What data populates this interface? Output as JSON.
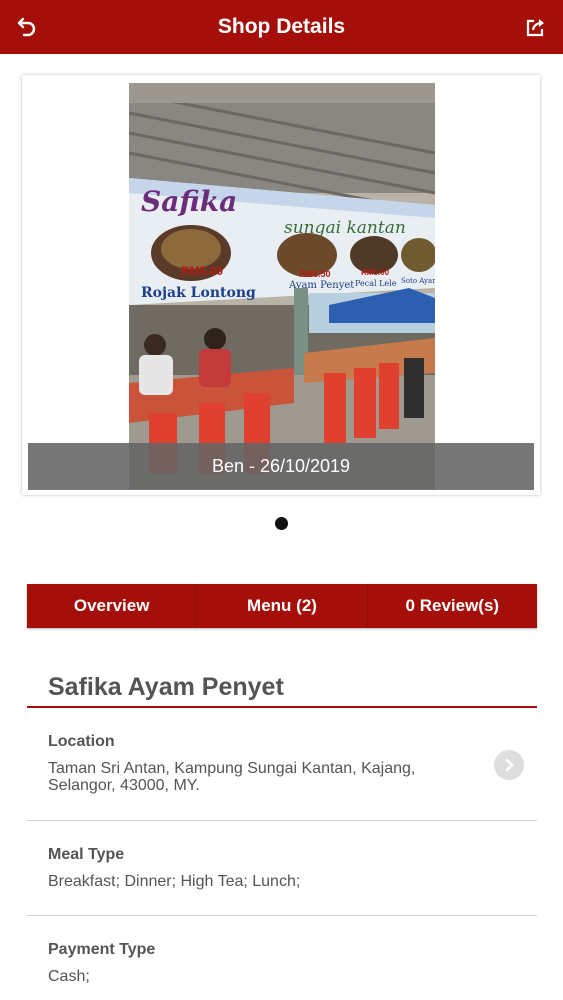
{
  "header": {
    "title": "Shop Details",
    "back_icon": "back-arrow-icon",
    "share_icon": "share-icon"
  },
  "gallery": {
    "caption": "Ben - 26/10/2019",
    "page_count": 1,
    "current_page": 1,
    "photo_signage": {
      "shop": "Safika",
      "place": "sungai kantan",
      "dish1_price": "RM5.00",
      "dish1_name": "Rojak Lontong",
      "dish2_price": "RM6.50",
      "dish2_name": "Ayam Penyet",
      "dish3_price": "RM5.00",
      "dish3_name": "Pecal Lele",
      "dish4_name": "Soto Ayam"
    }
  },
  "tabs": [
    {
      "label": "Overview"
    },
    {
      "label": "Menu (2)"
    },
    {
      "label": "0 Review(s)"
    }
  ],
  "shop": {
    "name": "Safika Ayam Penyet",
    "location_label": "Location",
    "location_value": "Taman Sri Antan, Kampung Sungai Kantan, Kajang, Selangor, 43000, MY.",
    "meal_type_label": "Meal Type",
    "meal_type_value": "Breakfast; Dinner; High Tea; Lunch;",
    "payment_type_label": "Payment Type",
    "payment_type_value": "Cash;"
  },
  "colors": {
    "brand_red": "#a50f0a",
    "text_gray": "#555555"
  }
}
